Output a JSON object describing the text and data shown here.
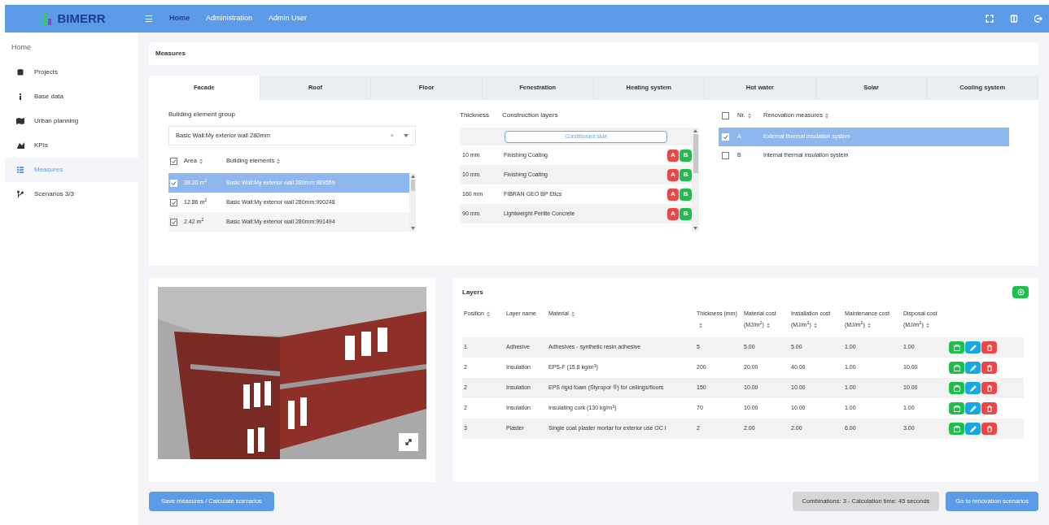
{
  "header": {
    "logo_text": "BIMERR",
    "menu_glyph": "☰",
    "nav": [
      {
        "label": "Home",
        "selected": true
      },
      {
        "label": "Administration",
        "selected": false
      },
      {
        "label": "Admin User",
        "selected": false
      }
    ]
  },
  "sidebar": {
    "home_label": "Home",
    "items": [
      {
        "label": "Projects",
        "selected": false
      },
      {
        "label": "Base data",
        "selected": false
      },
      {
        "label": "Urban planning",
        "selected": false
      },
      {
        "label": "KPIs",
        "selected": false
      },
      {
        "label": "Measures",
        "selected": true
      },
      {
        "label": "Scenarios 3/3",
        "selected": false
      }
    ]
  },
  "page_title": "Measures",
  "tabs": [
    {
      "label": "Facade",
      "selected": true
    },
    {
      "label": "Roof",
      "selected": false
    },
    {
      "label": "Floor",
      "selected": false
    },
    {
      "label": "Fenestration",
      "selected": false
    },
    {
      "label": "Heating system",
      "selected": false
    },
    {
      "label": "Hot water",
      "selected": false
    },
    {
      "label": "Solar",
      "selected": false
    },
    {
      "label": "Cooling system",
      "selected": false
    }
  ],
  "element_group": {
    "label": "Building element group",
    "value": "Basic Wall:My exterior wall 280mm",
    "clear_glyph": "×"
  },
  "elements": {
    "header_checked": true,
    "columns": [
      "Area",
      "Building elements"
    ],
    "rows": [
      {
        "area": "38.20 m$^{2}$",
        "name": "Basic Wall:My exterior wall 280mm:989559",
        "checked": true,
        "selected": true
      },
      {
        "area": "12.86 m$^{2}$",
        "name": "Basic Wall:My exterior wall 280mm:990248",
        "checked": true,
        "selected": false
      },
      {
        "area": "2.42 m$^{2}$",
        "name": "Basic Wall:My exterior wall 280mm:991494",
        "checked": true,
        "selected": false
      }
    ]
  },
  "construction": {
    "columns": [
      "Thickness",
      "Construction layers"
    ],
    "conditioned_side": "Conditioned side",
    "rows": [
      {
        "thickness": "10 mm",
        "name": "Finishing Coating",
        "a": "A",
        "b": "B"
      },
      {
        "thickness": "10 mm",
        "name": "Finishing Coating",
        "a": "A",
        "b": "B"
      },
      {
        "thickness": "160 mm",
        "name": "FIBRAN GEO BP Etics",
        "a": "A",
        "b": "B"
      },
      {
        "thickness": "90 mm",
        "name": "Lightweight Perlite Concrete",
        "a": "A",
        "b": "B"
      }
    ]
  },
  "renovation": {
    "header_checked": false,
    "columns": [
      "Nr.",
      "Renovation measures"
    ],
    "rows": [
      {
        "nr": "A",
        "name": "External thermal insulation system",
        "checked": true,
        "selected": true
      },
      {
        "nr": "B",
        "name": "Internal thermal insulation system",
        "checked": false,
        "selected": false
      }
    ]
  },
  "layers": {
    "title": "Layers",
    "columns": [
      {
        "label": "Position",
        "sortable": true
      },
      {
        "label": "Layer name",
        "sortable": false
      },
      {
        "label": "Material",
        "sortable": true
      },
      {
        "label": "Thickness (mm)",
        "sortable": true
      },
      {
        "label": "Material cost (MJ/m$^{2}$)",
        "sortable": true
      },
      {
        "label": "Installation cost (MJ/m$^{2}$)",
        "sortable": true
      },
      {
        "label": "Maintenance cost (MJ/m$^{2}$)",
        "sortable": true
      },
      {
        "label": "Disposal cost (MJ/m$^{2}$)",
        "sortable": true
      }
    ],
    "rows": [
      [
        "1",
        "Adhesive",
        "Adhesives - synthetic resin adhesive",
        "5",
        "5.00",
        "5.00",
        "1.00",
        "1.00"
      ],
      [
        "2",
        "Insulation",
        "EPS-F (15.8 kg/m$^{3}$)",
        "200",
        "20.00",
        "40.00",
        "1.00",
        "10.00"
      ],
      [
        "2",
        "Insulation",
        "EPS rigid foam (Styropor ®) for ceilings/floors",
        "150",
        "10.00",
        "10.00",
        "1.00",
        "10.00"
      ],
      [
        "2",
        "Insulation",
        "Insulating cork (130 kg/m$^{3}$)",
        "70",
        "10.00",
        "10.00",
        "1.00",
        "1.00"
      ],
      [
        "3",
        "Plaster",
        "Single coat plaster mortar for exterior use OC I",
        "2",
        "2.00",
        "2.00",
        "6.00",
        "3.00"
      ]
    ]
  },
  "footer": {
    "save_button": "Save measures / Calculate scenarios",
    "combinations": "Combinations: 3 - Calculation time: 45 seconds",
    "go_button": "Go to renovation scenarios"
  }
}
